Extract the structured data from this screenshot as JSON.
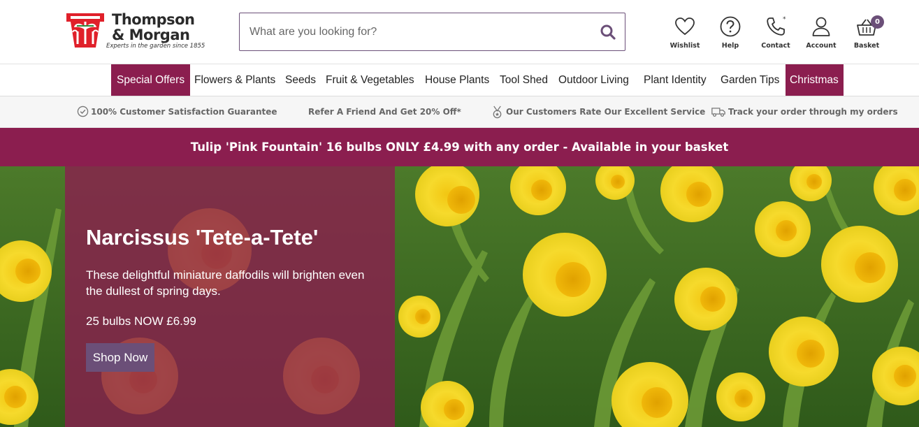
{
  "brand": {
    "name_line1": "Thompson",
    "name_line2": "& Morgan",
    "tagline": "Experts in the garden since 1855"
  },
  "search": {
    "placeholder": "What are you looking for?",
    "value": ""
  },
  "utilities": [
    {
      "label": "Wishlist",
      "icon": "heart-icon"
    },
    {
      "label": "Help",
      "icon": "question-icon"
    },
    {
      "label": "Contact",
      "icon": "phone-icon",
      "marker": "*"
    },
    {
      "label": "Account",
      "icon": "user-icon"
    },
    {
      "label": "Basket",
      "icon": "basket-icon",
      "count": "0"
    }
  ],
  "nav": [
    {
      "label": "Special Offers",
      "highlight": true
    },
    {
      "label": "Flowers & Plants"
    },
    {
      "label": "Seeds"
    },
    {
      "label": "Fruit & Vegetables"
    },
    {
      "label": "House Plants"
    },
    {
      "label": "Tool Shed"
    },
    {
      "label": "Outdoor Living"
    },
    {
      "label": "Plant Identity"
    },
    {
      "label": "Garden Tips"
    },
    {
      "label": "Christmas",
      "highlight": true
    }
  ],
  "benefits": [
    {
      "text": "100% Customer Satisfaction Guarantee",
      "icon": "check-circle-icon"
    },
    {
      "text": "Refer A Friend And Get 20% Off*"
    },
    {
      "text": "Our Customers Rate Our Excellent Service",
      "icon": "medal-icon"
    },
    {
      "text": "Track your order through my orders",
      "icon": "truck-icon"
    }
  ],
  "promo": {
    "text": "Tulip 'Pink Fountain' 16 bulbs ONLY £4.99 with any order - Available in your basket"
  },
  "hero": {
    "title": "Narcissus 'Tete-a-Tete'",
    "description": "These delightful miniature daffodils will brighten even the dullest of spring days.",
    "price": "25 bulbs NOW £6.99",
    "cta": "Shop Now"
  },
  "colors": {
    "brand_plum": "#8b1e4f",
    "accent_purple": "#6b4f78",
    "logo_red": "#e0202a"
  }
}
